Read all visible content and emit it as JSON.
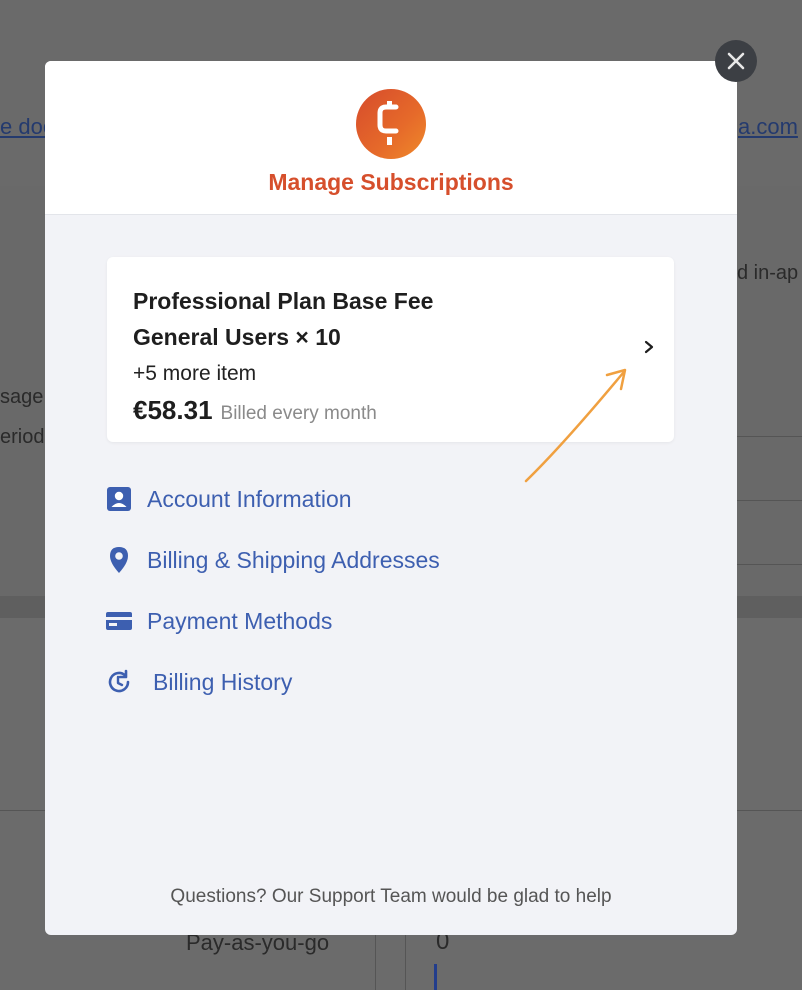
{
  "background": {
    "link_left": "e doc",
    "link_right": "a.com",
    "frag_inapp": "d in-ap",
    "frag_usage": "sage",
    "frag_period": "eriod",
    "frag_payg": "Pay-as-you-go",
    "frag_zero": "0"
  },
  "modal": {
    "close_icon": "close-icon",
    "logo_icon": "brand-logo-c",
    "title": "Manage Subscriptions",
    "subscription": {
      "line1": "Professional Plan Base Fee",
      "line2": "General Users × 10",
      "more": "+5 more item",
      "price": "€58.31",
      "billing": "Billed every month"
    },
    "menu": [
      {
        "label": "Account Information",
        "icon": "account-card-icon"
      },
      {
        "label": "Billing & Shipping Addresses",
        "icon": "location-pin-icon"
      },
      {
        "label": "Payment Methods",
        "icon": "credit-card-icon"
      },
      {
        "label": "Billing History",
        "icon": "history-icon"
      }
    ],
    "footer": "Questions? Our Support Team would be glad to help"
  },
  "colors": {
    "accent": "#d64f2c",
    "link": "#3d5fb0",
    "annotation": "#f0a040"
  }
}
